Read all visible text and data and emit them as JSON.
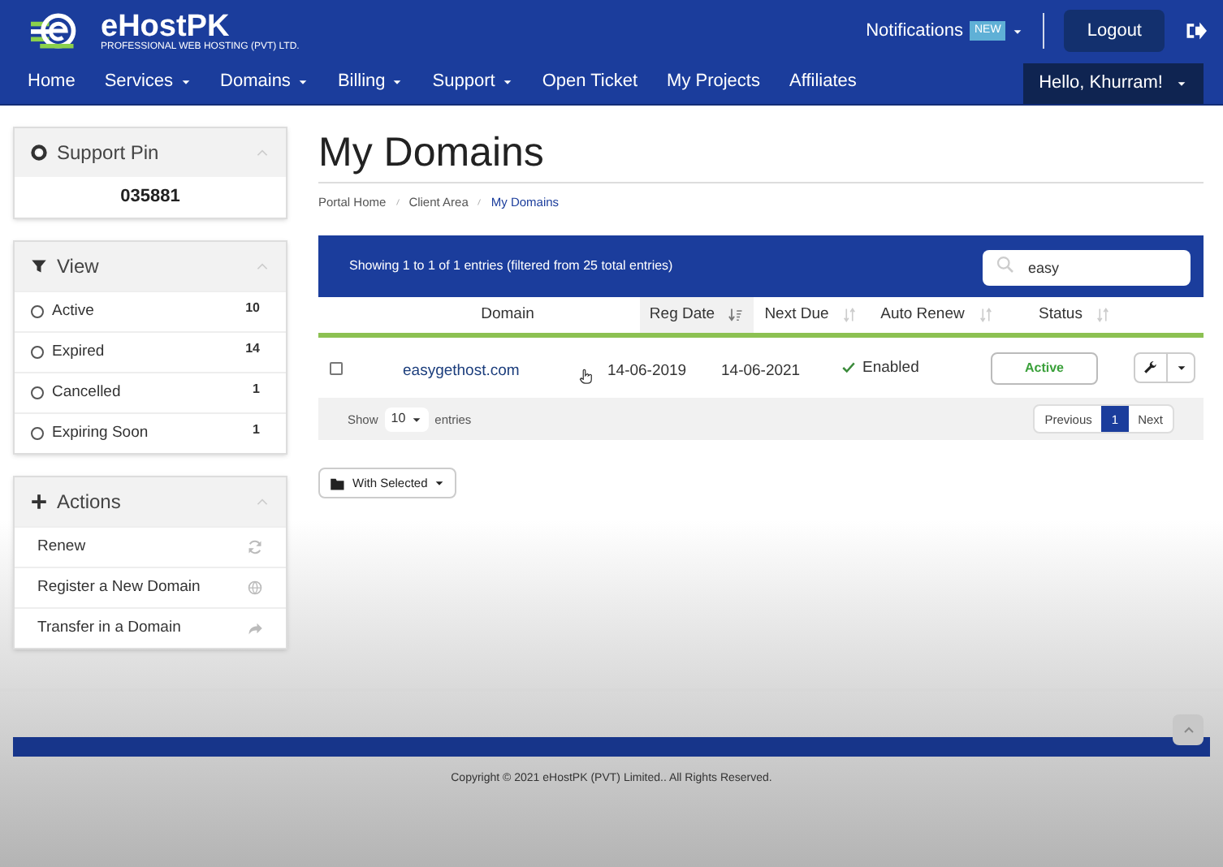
{
  "header": {
    "logo": {
      "name": "eHostPK",
      "tagline": "PROFESSIONAL WEB HOSTING (PVT) LTD."
    },
    "notifications": {
      "label": "Notifications",
      "badge": "NEW"
    },
    "logout": "Logout"
  },
  "nav": {
    "items": [
      {
        "label": "Home",
        "dropdown": false
      },
      {
        "label": "Services",
        "dropdown": true
      },
      {
        "label": "Domains",
        "dropdown": true
      },
      {
        "label": "Billing",
        "dropdown": true
      },
      {
        "label": "Support",
        "dropdown": true
      },
      {
        "label": "Open Ticket",
        "dropdown": false
      },
      {
        "label": "My Projects",
        "dropdown": false
      },
      {
        "label": "Affiliates",
        "dropdown": false
      }
    ],
    "account": "Hello, Khurram!"
  },
  "sidebar": {
    "support_pin": {
      "title": "Support Pin",
      "value": "035881"
    },
    "view": {
      "title": "View",
      "items": [
        {
          "label": "Active",
          "count": "10",
          "selected": false
        },
        {
          "label": "Expired",
          "count": "14",
          "selected": false
        },
        {
          "label": "Cancelled",
          "count": "1",
          "selected": false
        },
        {
          "label": "Expiring Soon",
          "count": "1",
          "selected": false
        }
      ]
    },
    "actions": {
      "title": "Actions",
      "items": [
        {
          "label": "Renew",
          "kind": "refresh"
        },
        {
          "label": "Register a New Domain",
          "kind": "globe"
        },
        {
          "label": "Transfer in a Domain",
          "kind": "share"
        }
      ]
    }
  },
  "page": {
    "title": "My Domains",
    "breadcrumb": [
      {
        "label": "Portal Home",
        "selected": false
      },
      {
        "label": "Client Area",
        "selected": false
      },
      {
        "label": "My Domains",
        "selected": true
      }
    ]
  },
  "table": {
    "info": "Showing 1 to 1 of 1 entries (filtered from 25 total entries)",
    "search": {
      "value": "easy"
    },
    "columns": [
      {
        "label": "Domain",
        "sortable": false,
        "sorted": false
      },
      {
        "label": "Reg Date",
        "sortable": true,
        "sorted": true
      },
      {
        "label": "Next Due",
        "sortable": true,
        "sorted": false
      },
      {
        "label": "Auto Renew",
        "sortable": true,
        "sorted": false
      },
      {
        "label": "Status",
        "sortable": true,
        "sorted": false
      }
    ],
    "rows": [
      {
        "checked": false,
        "domain": "easygethost.com",
        "reg_date": "14-06-2019",
        "next_due": "14-06-2021",
        "auto_renew": "Enabled",
        "status": "Active"
      }
    ],
    "length": {
      "before": "Show",
      "value": "10",
      "after": "entries"
    },
    "pagination": [
      {
        "label": "Previous",
        "selected": false
      },
      {
        "label": "1",
        "selected": true
      },
      {
        "label": "Next",
        "selected": false
      }
    ]
  },
  "bulk_button": "With Selected",
  "footer": {
    "copyright": "Copyright © 2021 eHostPK (PVT) Limited.. All Rights Reserved."
  }
}
